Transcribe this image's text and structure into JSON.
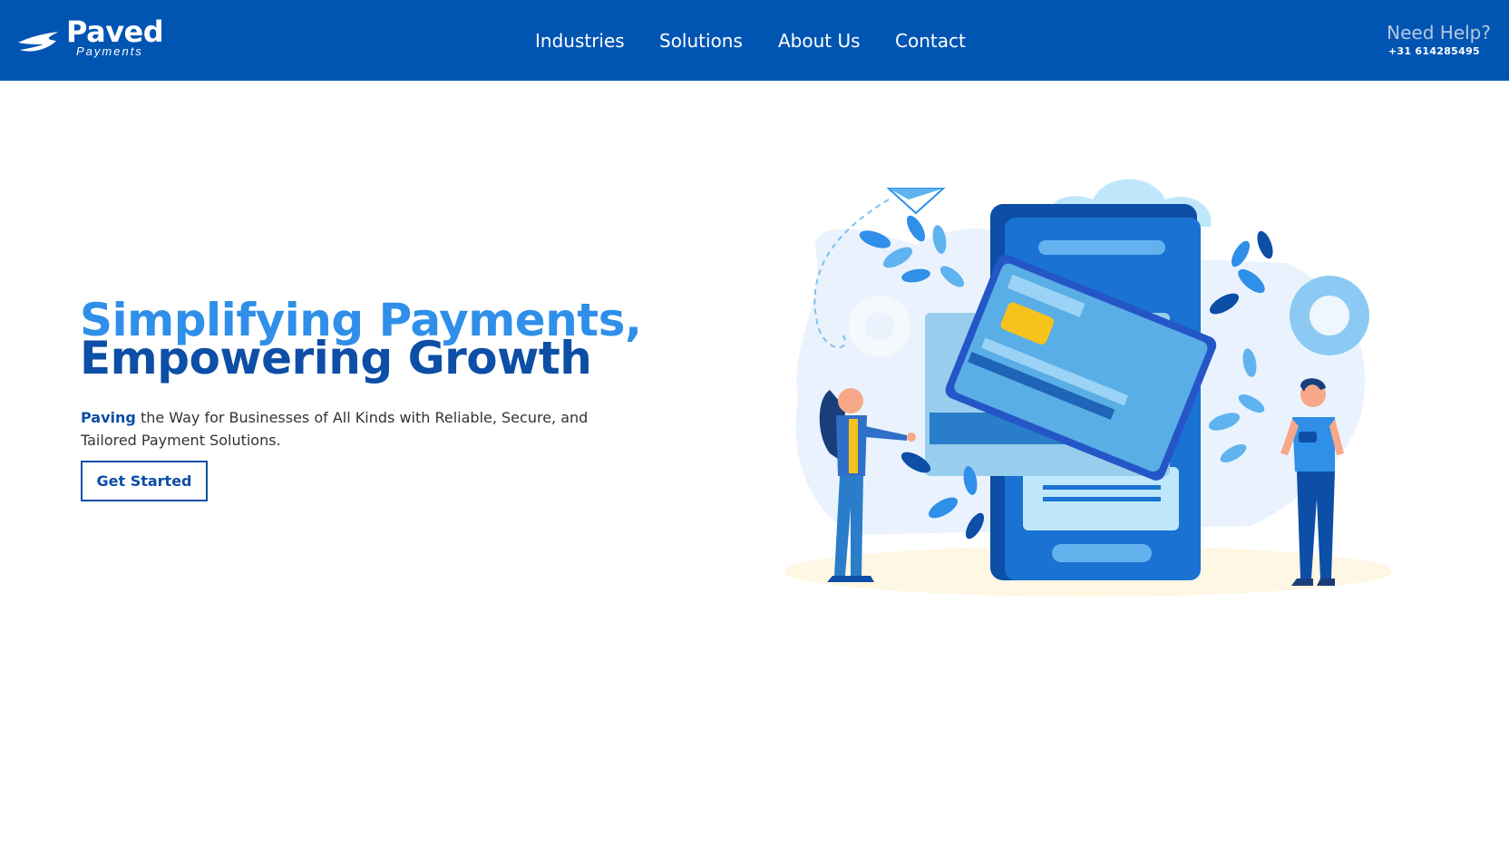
{
  "brand": {
    "name": "Paved",
    "tagline": "Payments",
    "color": "#0055b3"
  },
  "nav": {
    "items": [
      "Industries",
      "Solutions",
      "About Us",
      "Contact"
    ]
  },
  "help": {
    "title": "Need Help?",
    "phone": "+31 614285495"
  },
  "hero": {
    "title_line1": "Simplifying Payments,",
    "title_line2": "Empowering Growth",
    "desc_strong": "Paving",
    "desc_rest": " the Way for Businesses of All Kinds with Reliable, Secure, and Tailored Payment Solutions.",
    "cta_label": "Get Started"
  },
  "colors": {
    "accent_light": "#2f8fe9",
    "accent_dark": "#0d4ea6"
  }
}
